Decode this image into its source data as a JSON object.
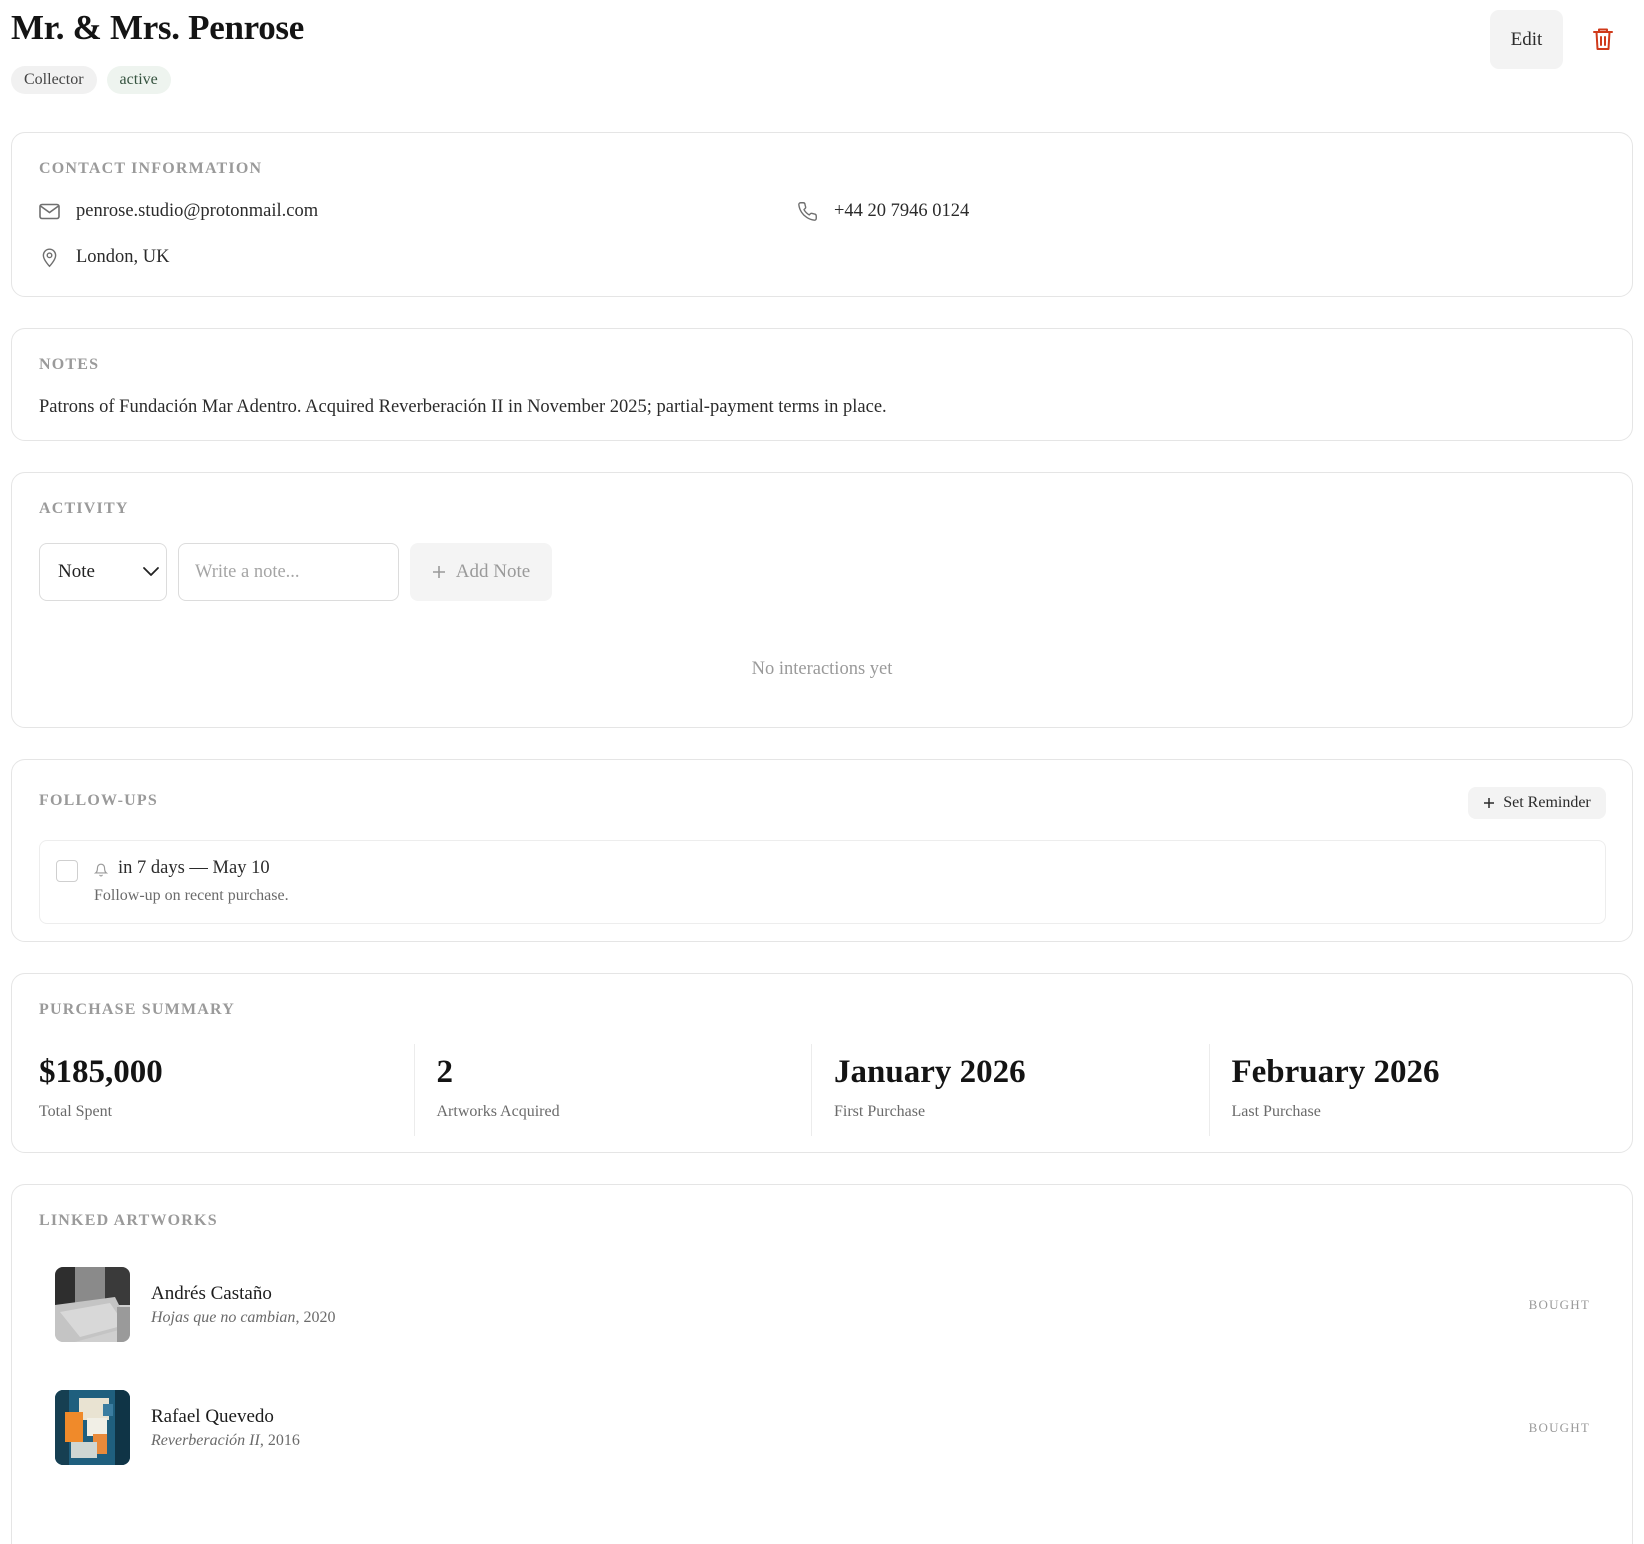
{
  "contact_header": {
    "name": "Mr. & Mrs. Penrose",
    "tags": {
      "role": "Collector",
      "status": "active"
    },
    "edit_label": "Edit",
    "delete_icon": "trash-icon",
    "colors": {
      "delete": "#d03a1b",
      "status_bg": "#eef4ef",
      "status_text": "#34523e"
    }
  },
  "contact_info": {
    "section_title": "CONTACT INFORMATION",
    "email": "penrose.studio@protonmail.com",
    "phone": "+44 20 7946 0124",
    "location": "London, UK",
    "icons": {
      "email": "mail-icon",
      "phone": "phone-icon",
      "location": "map-pin-icon"
    }
  },
  "notes": {
    "section_title": "NOTES",
    "text": "Patrons of Fundación Mar Adentro. Acquired Reverberación II in November 2025; partial-payment terms in place."
  },
  "activity": {
    "section_title": "ACTIVITY",
    "type_selected": "Note",
    "input_placeholder": "Write a note...",
    "add_label": "Add Note",
    "empty_text": "No interactions yet"
  },
  "followups": {
    "section_title": "FOLLOW-UPS",
    "reminder_label": "Set Reminder",
    "items": [
      {
        "when": "in 7 days — May 10",
        "description": "Follow-up on recent purchase.",
        "done": false
      }
    ]
  },
  "purchase_summary": {
    "section_title": "PURCHASE SUMMARY",
    "stats": [
      {
        "value": "$185,000",
        "label": "Total Spent"
      },
      {
        "value": "2",
        "label": "Artworks Acquired"
      },
      {
        "value": "January 2026",
        "label": "First Purchase"
      },
      {
        "value": "February 2026",
        "label": "Last Purchase"
      }
    ]
  },
  "linked_artworks": {
    "section_title": "LINKED ARTWORKS",
    "items": [
      {
        "artist": "Andrés Castaño",
        "title": "Hojas que no cambian",
        "year": ", 2020",
        "status": "BOUGHT"
      },
      {
        "artist": "Rafael Quevedo",
        "title": "Reverberación II",
        "year": ", 2016",
        "status": "BOUGHT"
      }
    ]
  }
}
